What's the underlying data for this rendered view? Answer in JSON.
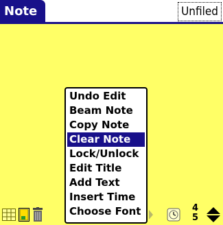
{
  "title_bar": {
    "title": "Note",
    "category": "Unfiled"
  },
  "menu": {
    "selected_index": 3,
    "items": [
      {
        "label": "Undo Edit"
      },
      {
        "label": "Beam Note"
      },
      {
        "label": "Copy Note"
      },
      {
        "label": "Clear Note"
      },
      {
        "label": "Lock/Unlock"
      },
      {
        "label": "Edit Title"
      },
      {
        "label": "Add Text"
      },
      {
        "label": "Insert Time"
      },
      {
        "label": "Choose Font"
      }
    ]
  },
  "toolbar": {
    "icons": [
      "grid-view-icon",
      "memo-icon",
      "trash-icon",
      "clock-icon",
      "scroll-arrows-icon"
    ],
    "page_numbers": [
      "4",
      "5"
    ]
  },
  "colors": {
    "background": "#ffff66",
    "accent": "#18108a",
    "menu": "#ffffff"
  }
}
